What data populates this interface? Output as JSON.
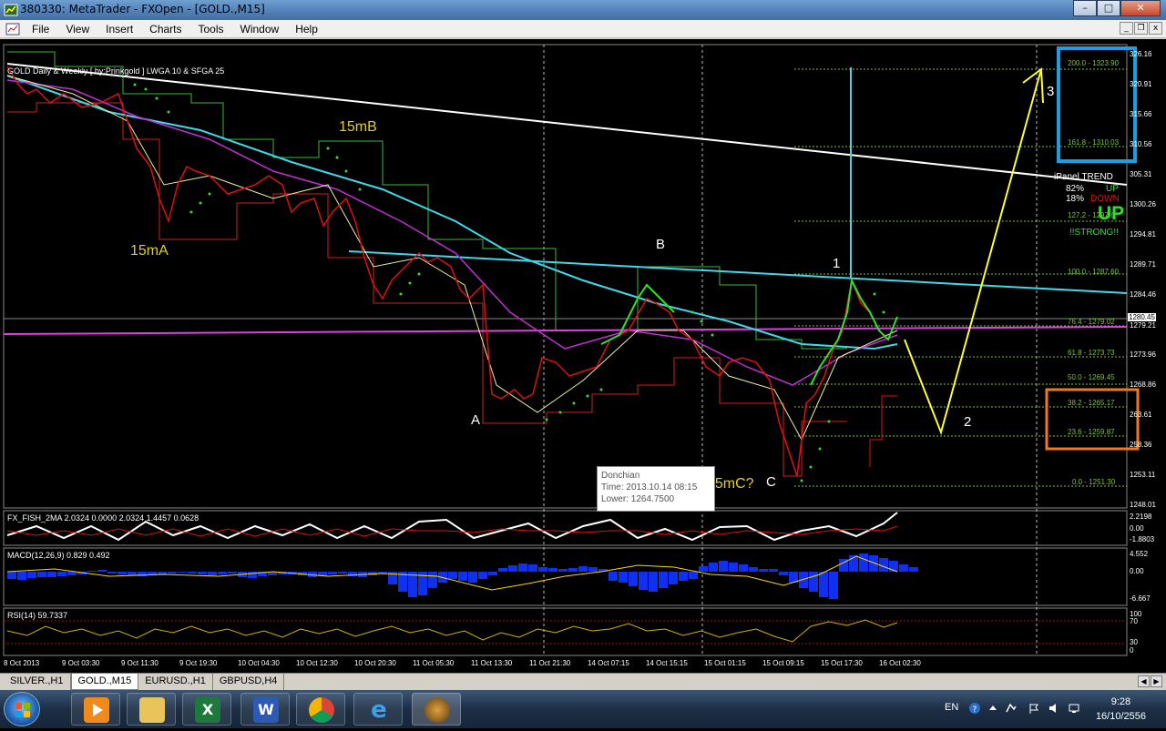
{
  "window": {
    "title": "380330: MetaTrader - FXOpen - [GOLD.,M15]"
  },
  "menu": [
    "File",
    "View",
    "Insert",
    "Charts",
    "Tools",
    "Window",
    "Help"
  ],
  "chart": {
    "header": "GOLD Daily & Weekly [ by:Prinkgold ] LWGA 10 & SFGA 25",
    "price_axis": [
      "326.16",
      "320.91",
      "315.66",
      "310.56",
      "305.31",
      "1300.26",
      "1294.81",
      "1289.71",
      "1284.46",
      "1280.45",
      "1279.21",
      "1273.96",
      "1268.86",
      "263.61",
      "258.36",
      "1253.11",
      "1248.01"
    ],
    "current_price": "1280.45",
    "fib_levels": [
      "200.0 - 1323.90",
      "161.8 - 1310.03",
      "127.2 - 1297.6",
      "100.0 - 1287.60",
      "76.4 - 1279.02",
      "61.8 - 1273.73",
      "50.0 - 1269.45",
      "38.2 - 1265.17",
      "23.6 - 1259.87",
      "0.0 - 1251.30"
    ],
    "labels": {
      "m15a": "15mA",
      "m15b": "15mB",
      "m15c": "15mC?",
      "pa": "A",
      "pb": "B",
      "pc": "C",
      "w1": "1",
      "w2": "2",
      "w3": "3"
    },
    "ipanel": {
      "title": "iPanel  TREND",
      "pct_up": "82%",
      "up": "UP",
      "pct_down": "18%",
      "down": "DOWN",
      "big": "UP",
      "strong": "!!STRONG!!"
    },
    "tooltip": {
      "name": "Donchian",
      "time": "Time: 2013.10.14 08:15",
      "lower": "Lower: 1264.7500"
    },
    "fisher": {
      "label": "FX_FISH_2MA 2.0324 0.0000 2.0324 1.4457 0.0628",
      "scale": [
        "2.2198",
        "0.00",
        "-1.8803"
      ]
    },
    "macd": {
      "label": "MACD(12,26,9) 0.829 0.492",
      "scale": [
        "4.552",
        "0.00",
        "-6.667"
      ]
    },
    "rsi": {
      "label": "RSI(14) 59.7337",
      "scale": [
        "100",
        "70",
        "30",
        "0"
      ]
    },
    "time_axis": [
      "8 Oct 2013",
      "9 Oct 03:30",
      "9 Oct 11:30",
      "9 Oct 19:30",
      "10 Oct 04:30",
      "10 Oct 12:30",
      "10 Oct 20:30",
      "11 Oct 05:30",
      "11 Oct 13:30",
      "11 Oct 21:30",
      "14 Oct 07:15",
      "14 Oct 15:15",
      "15 Oct 01:15",
      "15 Oct 09:15",
      "15 Oct 17:30",
      "16 Oct 02:30"
    ]
  },
  "tabs": [
    "SILVER.,H1",
    "GOLD.,M15",
    "EURUSD.,H1",
    "GBPUSD,H4"
  ],
  "active_tab": "GOLD.,M15",
  "taskbar": {
    "apps": [
      "media-player",
      "file-explorer",
      "excel",
      "word",
      "chrome",
      "internet-explorer",
      "metatrader"
    ],
    "lang": "EN",
    "time": "9:28",
    "date": "16/10/2556"
  },
  "colors": {
    "fib": "#7fc42a",
    "trend_white": "#ffffff",
    "trend_cyan": "#40d8e8",
    "magenta": "#e040e0",
    "projection": "#ffff30",
    "label_yellow": "#e0d020",
    "box_blue": "#1aa0e0",
    "box_orange": "#f07a1a",
    "candle_red": "#e01010",
    "candle_green": "#30e030",
    "macd_hist": "#1030f0"
  }
}
